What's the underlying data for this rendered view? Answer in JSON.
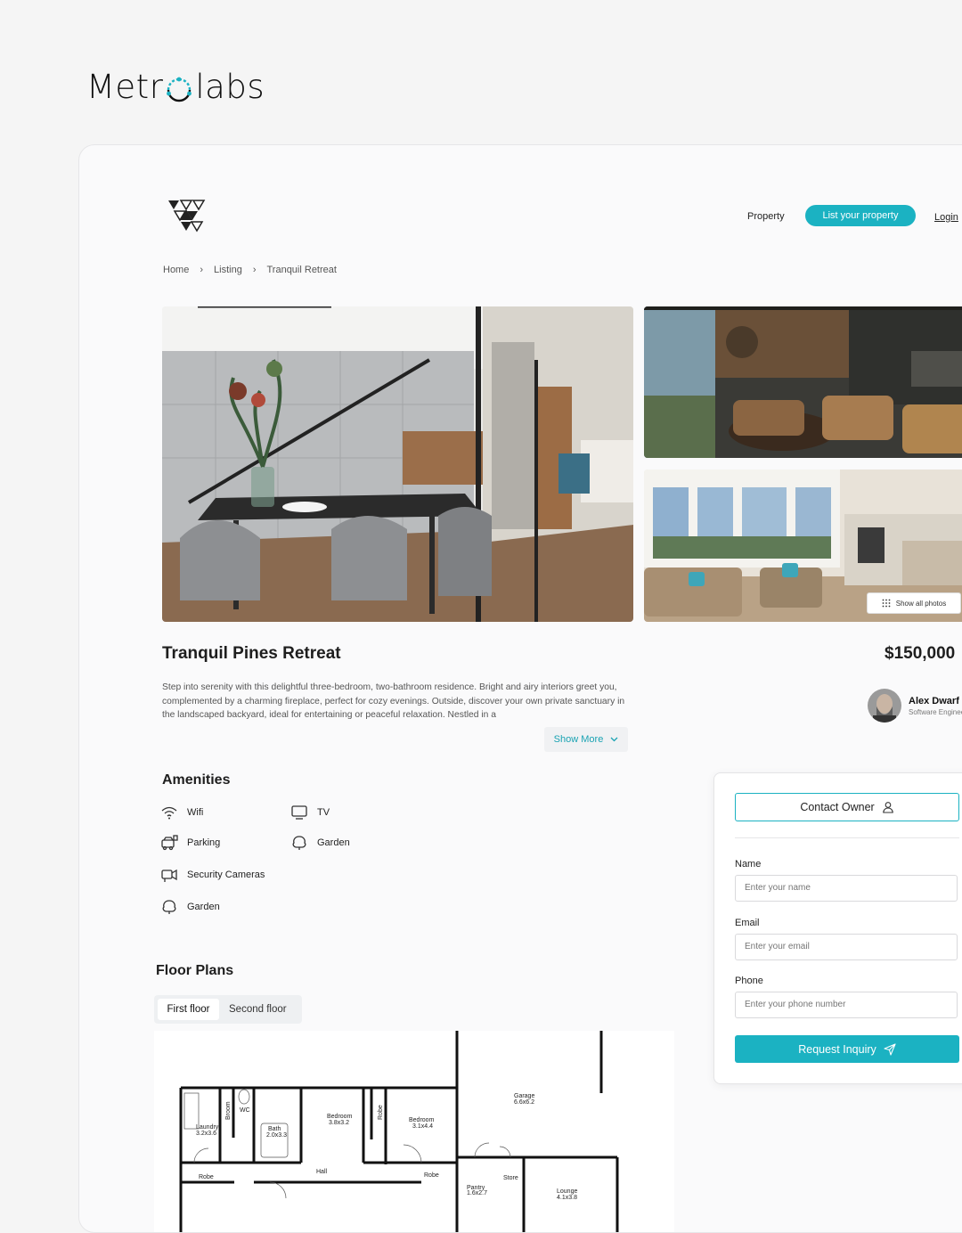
{
  "brand": {
    "left": "Metr",
    "right": "labs"
  },
  "nav": {
    "property": "Property",
    "list_property": "List your property",
    "login": "Login"
  },
  "breadcrumbs": [
    "Home",
    "Listing",
    "Tranquil Retreat"
  ],
  "gallery": {
    "show_all": "Show all photos"
  },
  "listing": {
    "title": "Tranquil Pines Retreat",
    "price": "$150,000",
    "description": "Step into serenity with this delightful three-bedroom, two-bathroom residence. Bright and airy interiors greet you, complemented by a charming fireplace, perfect for cozy evenings. Outside, discover your own private sanctuary in the landscaped backyard, ideal for entertaining or peaceful relaxation. Nestled in a",
    "show_more": "Show More"
  },
  "agent": {
    "name": "Alex Dwarf",
    "role": "Software Engineer"
  },
  "amenities": {
    "heading": "Amenities",
    "items": [
      {
        "label": "Wifi",
        "icon": "wifi-icon"
      },
      {
        "label": "TV",
        "icon": "tv-icon"
      },
      {
        "label": "Parking",
        "icon": "parking-icon"
      },
      {
        "label": "Garden",
        "icon": "garden-icon"
      },
      {
        "label": "Security Cameras",
        "icon": "camera-icon"
      },
      {
        "label": "Garden",
        "icon": "garden-icon"
      }
    ]
  },
  "floor_plans": {
    "heading": "Floor Plans",
    "tabs": [
      "First floor",
      "Second floor"
    ],
    "rooms": [
      {
        "name": "Laundry",
        "dims": "3.2x3.6"
      },
      {
        "name": "Broom",
        "dims": ""
      },
      {
        "name": "WC",
        "dims": ""
      },
      {
        "name": "Bath",
        "dims": "2.0x3.3"
      },
      {
        "name": "Bedroom",
        "dims": "3.8x3.2"
      },
      {
        "name": "Robe",
        "dims": ""
      },
      {
        "name": "Bedroom",
        "dims": "3.1x4.4"
      },
      {
        "name": "Garage",
        "dims": "6.6x6.2"
      },
      {
        "name": "Hall",
        "dims": ""
      },
      {
        "name": "Robe",
        "dims": ""
      },
      {
        "name": "Robe",
        "dims": ""
      },
      {
        "name": "Store",
        "dims": ""
      },
      {
        "name": "Pantry",
        "dims": "1.6x2.7"
      },
      {
        "name": "Lounge",
        "dims": "4.1x3.8"
      }
    ]
  },
  "contact_form": {
    "contact_owner": "Contact Owner",
    "name_label": "Name",
    "name_placeholder": "Enter your name",
    "email_label": "Email",
    "email_placeholder": "Enter your email",
    "phone_label": "Phone",
    "phone_placeholder": "Enter your phone number",
    "submit": "Request Inquiry"
  },
  "colors": {
    "accent": "#1bb2c2",
    "background": "#f5f5f5",
    "card": "#fafafb"
  }
}
